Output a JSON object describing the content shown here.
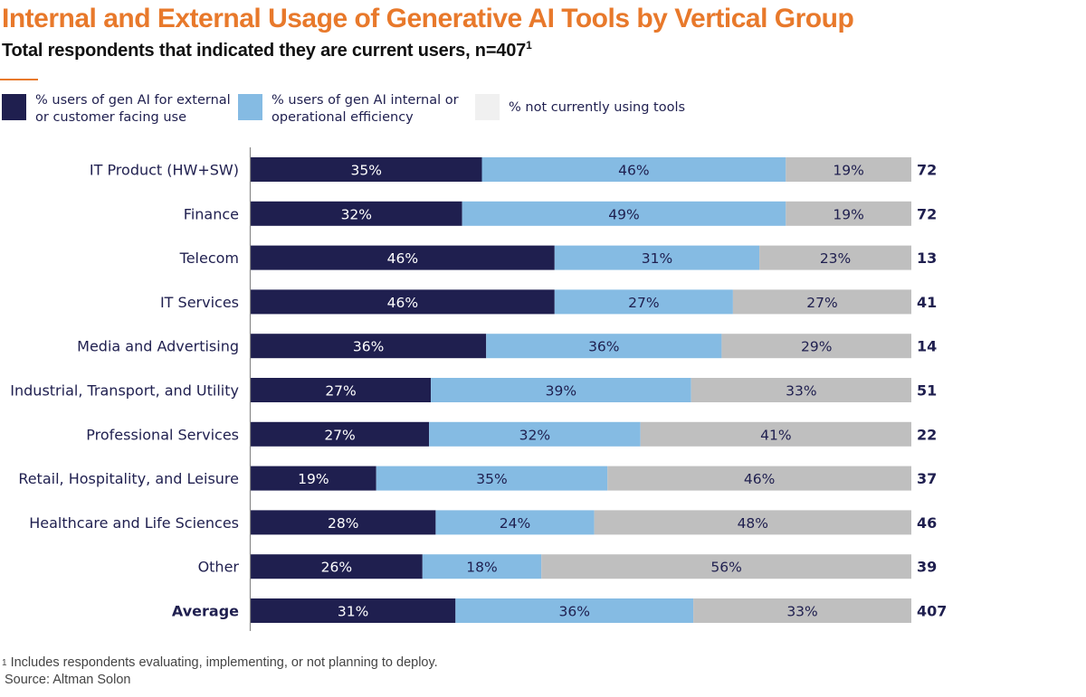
{
  "header": {
    "title": "Internal and External Usage of Generative AI Tools by Vertical Group",
    "subtitle": "Total respondents that indicated they are current users, n=407",
    "subtitle_superscript": "1"
  },
  "colors": {
    "accent": "#e8792b",
    "external": "#1f1f4f",
    "internal": "#85bbe3",
    "not_using": "#bfbfbf",
    "legend_not_using": "#f0f0f0"
  },
  "legend": [
    {
      "key": "external",
      "label": "% users of gen AI for external or customer facing use"
    },
    {
      "key": "internal",
      "label": "% users of gen AI internal or operational efficiency"
    },
    {
      "key": "not_using",
      "label": "% not currently using tools"
    }
  ],
  "chart_data": {
    "type": "bar",
    "orientation": "horizontal",
    "stacked": true,
    "title": "Internal and External Usage of Generative AI Tools by Vertical Group",
    "subtitle": "Total respondents that indicated they are current users, n=407",
    "xlabel": "",
    "ylabel": "",
    "xlim": [
      0,
      100
    ],
    "unit": "%",
    "grid": false,
    "legend_position": "top",
    "categories": [
      "IT Product (HW+SW)",
      "Finance",
      "Telecom",
      "IT Services",
      "Media and Advertising",
      "Industrial, Transport, and Utility",
      "Professional Services",
      "Retail, Hospitality, and Leisure",
      "Healthcare and Life Sciences",
      "Other",
      "Average"
    ],
    "bold_categories": [
      "Average"
    ],
    "series": [
      {
        "name": "% users of gen AI for external or customer facing use",
        "key": "external",
        "values": [
          35,
          32,
          46,
          46,
          36,
          27,
          27,
          19,
          28,
          26,
          31
        ]
      },
      {
        "name": "% users of gen AI internal or operational efficiency",
        "key": "internal",
        "values": [
          46,
          49,
          31,
          27,
          36,
          39,
          32,
          35,
          24,
          18,
          36
        ]
      },
      {
        "name": "% not currently using tools",
        "key": "not_using",
        "values": [
          19,
          19,
          23,
          27,
          29,
          33,
          41,
          46,
          48,
          56,
          33
        ]
      }
    ],
    "n_values": [
      72,
      72,
      13,
      41,
      14,
      51,
      22,
      37,
      46,
      39,
      407
    ]
  },
  "footer": {
    "footnote_marker": "1",
    "footnote": "Includes respondents evaluating, implementing, or not planning to deploy.",
    "source": "Source: Altman Solon"
  }
}
